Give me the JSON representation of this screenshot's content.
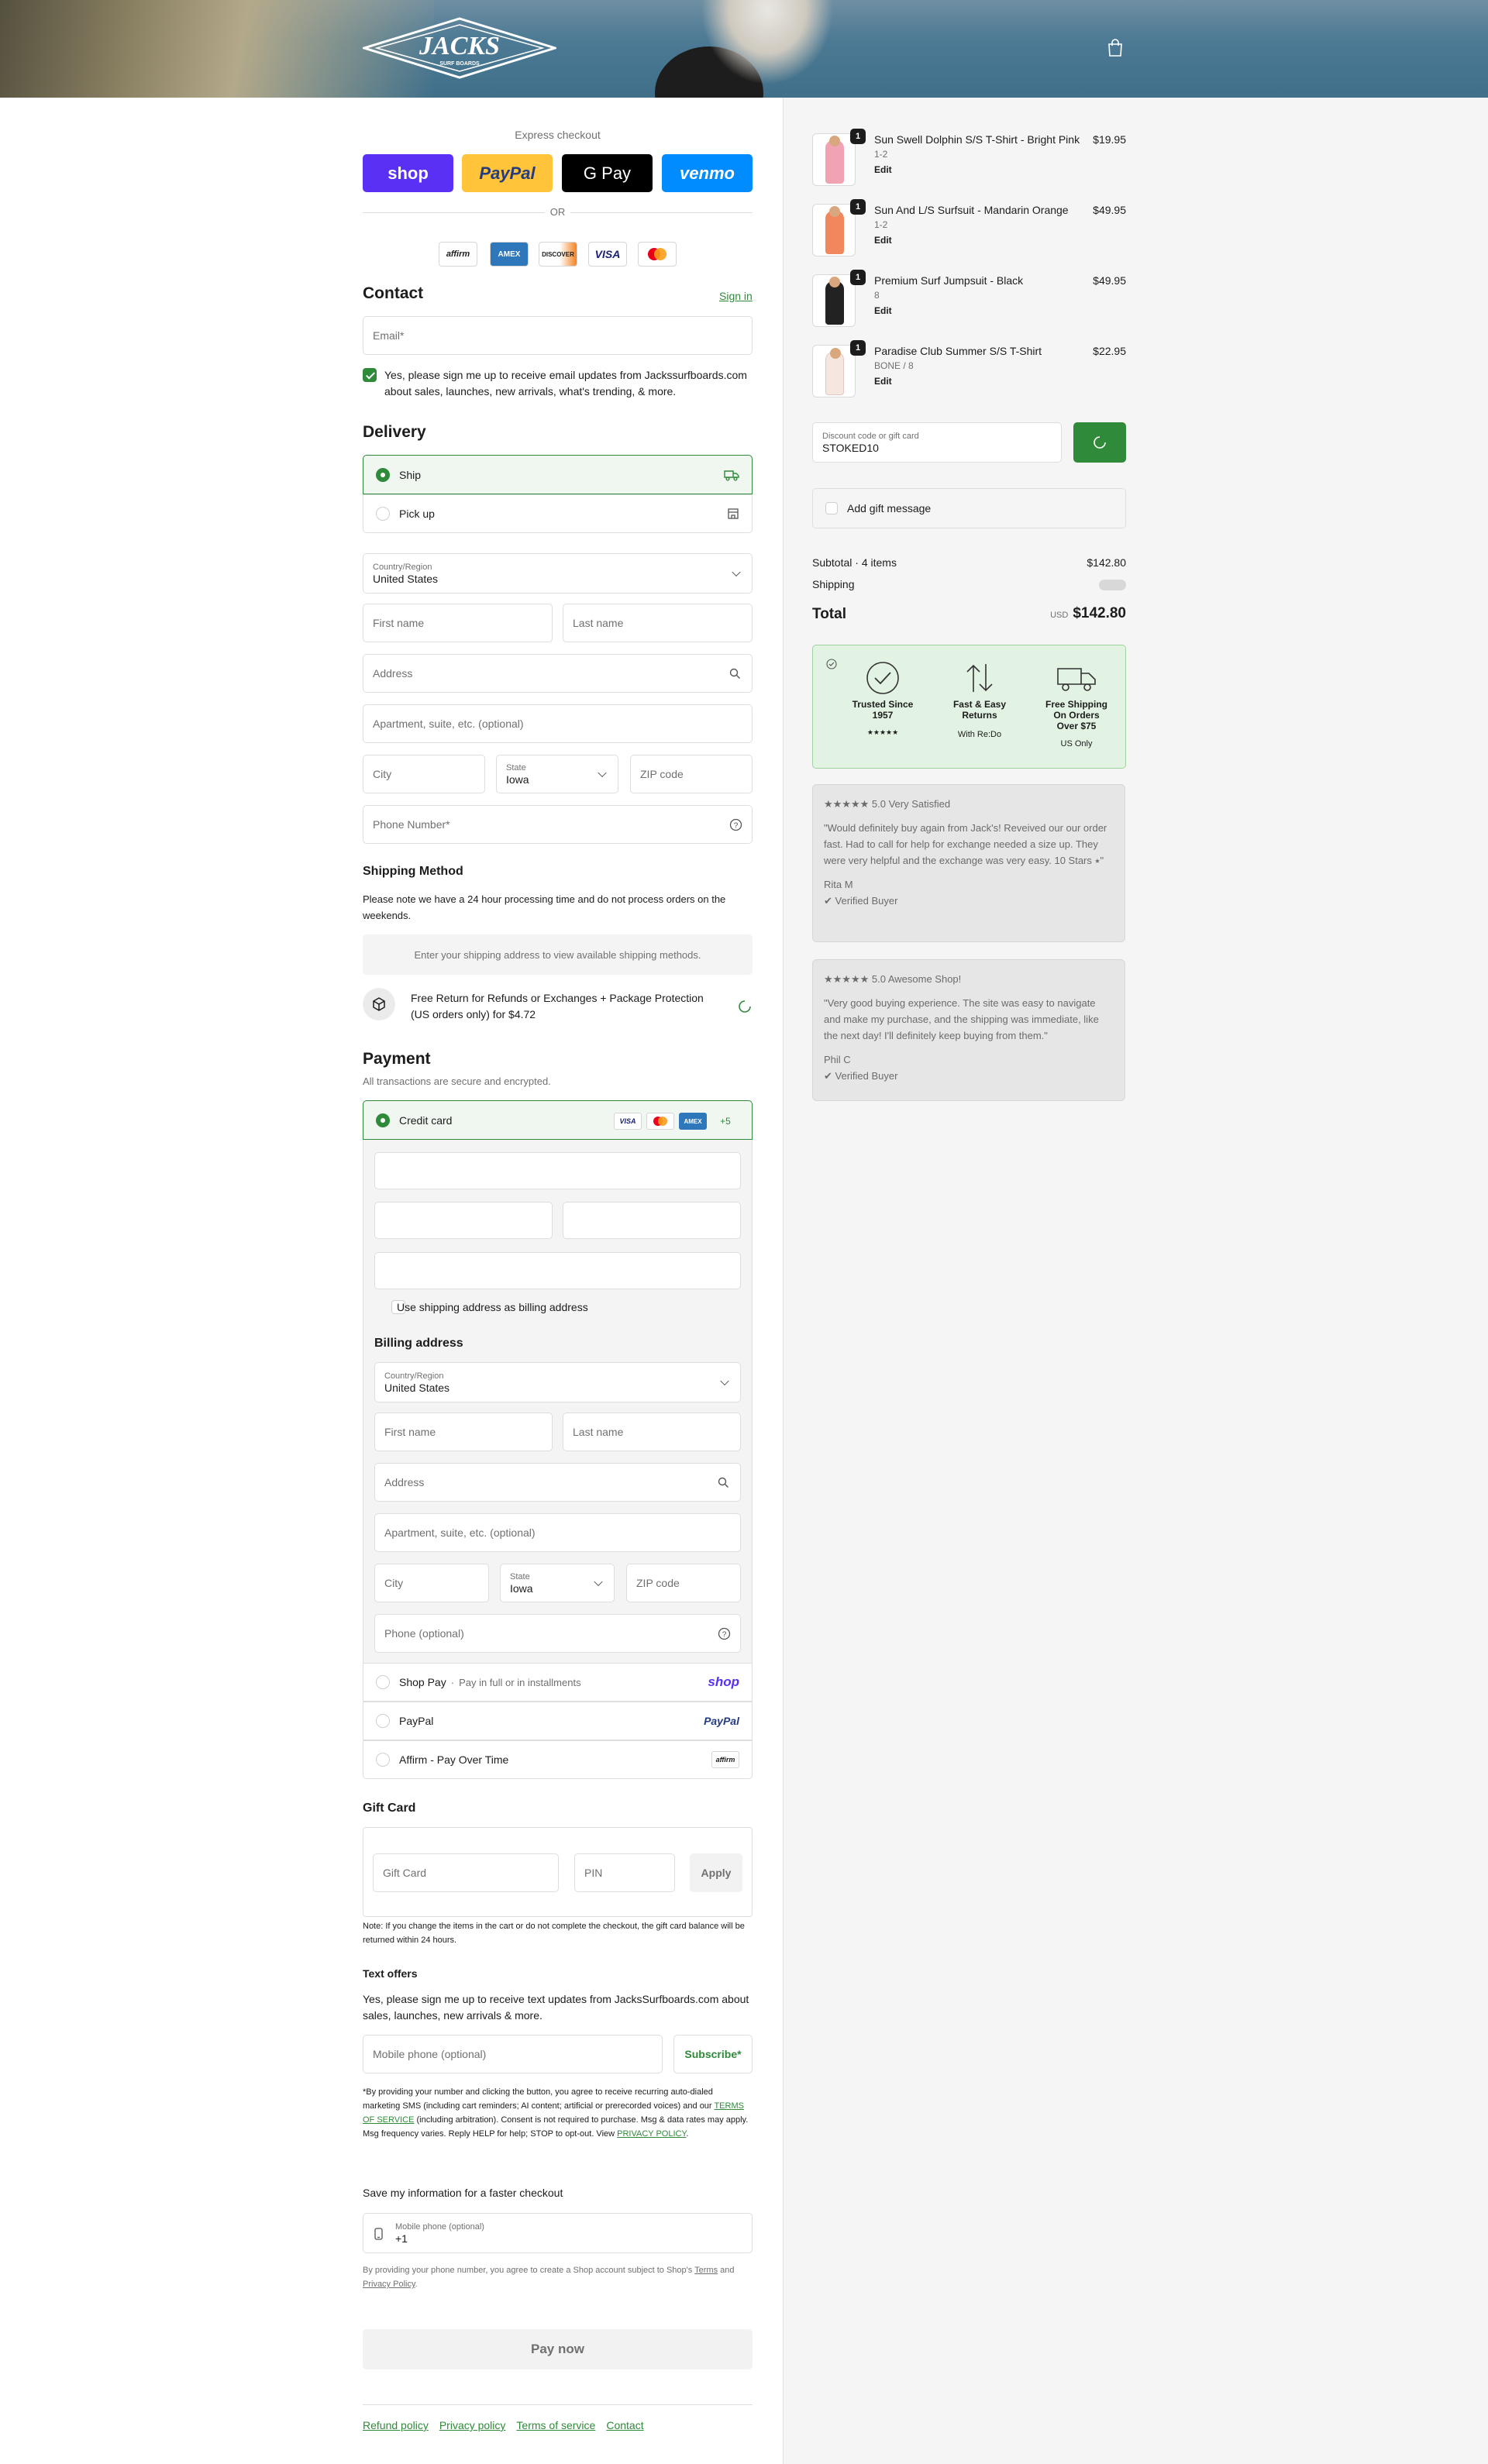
{
  "header": {
    "logo_text": "JACKS",
    "logo_subtext": "SURF BOARDS"
  },
  "express": {
    "title": "Express checkout",
    "buttons": {
      "shop": "shop",
      "paypal": "PayPal",
      "gpay": "G Pay",
      "venmo": "venmo"
    },
    "or": "OR",
    "cards": [
      "affirm",
      "AMEX",
      "DISCOVER",
      "VISA",
      "mastercard"
    ]
  },
  "contact": {
    "title": "Contact",
    "sign_in": "Sign in",
    "email_placeholder": "Email*",
    "newsletter": "Yes, please sign me up to receive email updates from Jackssurfboards.com about sales, launches, new arrivals, what's trending, & more."
  },
  "delivery": {
    "title": "Delivery",
    "ship": "Ship",
    "pickup": "Pick up",
    "country_label": "Country/Region",
    "country": "United States",
    "first_name": "First name",
    "last_name": "Last name",
    "address": "Address",
    "apartment": "Apartment, suite, etc. (optional)",
    "city": "City",
    "state_label": "State",
    "state": "Iowa",
    "zip": "ZIP code",
    "phone": "Phone Number*"
  },
  "shipping_method": {
    "title": "Shipping Method",
    "note": "Please note we have a 24 hour processing time and do not process orders on the weekends.",
    "empty": "Enter your shipping address to view available shipping methods.",
    "protection": "Free Return for Refunds or Exchanges + Package Protection (US orders only) for $4.72"
  },
  "payment": {
    "title": "Payment",
    "subtitle": "All transactions are secure and encrypted.",
    "credit_card": "Credit card",
    "more_cards": "+5",
    "card_brands": [
      "VISA",
      "mastercard",
      "AMEX"
    ],
    "use_shipping": "Use shipping address as billing address",
    "billing_title": "Billing address",
    "billing": {
      "country_label": "Country/Region",
      "country": "United States",
      "first_name": "First name",
      "last_name": "Last name",
      "address": "Address",
      "apartment": "Apartment, suite, etc. (optional)",
      "city": "City",
      "state_label": "State",
      "state": "Iowa",
      "zip": "ZIP code",
      "phone": "Phone (optional)"
    },
    "shop_pay": "Shop Pay",
    "shop_pay_sub": "Pay in full or in installments",
    "shop_pay_logo": "shop",
    "paypal": "PayPal",
    "paypal_logo": "PayPal",
    "affirm": "Affirm - Pay Over Time",
    "affirm_logo": "affirm"
  },
  "gift_card": {
    "title": "Gift Card",
    "placeholder": "Gift Card",
    "pin": "PIN",
    "apply": "Apply",
    "note": "Note: If you change the items in the cart or do not complete the checkout, the gift card balance will be returned within 24 hours."
  },
  "text_offers": {
    "title": "Text offers",
    "body": "Yes, please sign me up to receive text updates from JacksSurfboards.com about sales, launches, new arrivals & more.",
    "mobile_placeholder": "Mobile phone (optional)",
    "subscribe": "Subscribe*",
    "legal_1": "*By providing your number and clicking the button, you agree to receive recurring auto-dialed marketing SMS (including cart reminders; AI content; artificial or prerecorded voices) and our",
    "terms": "TERMS OF SERVICE",
    "legal_2": "(including arbitration). Consent is not required to purchase. Msg & data rates may apply. Msg frequency varies. Reply HELP for help; STOP to opt-out. View",
    "privacy": "PRIVACY POLICY",
    "legal_3": "."
  },
  "save_info": {
    "title": "Save my information for a faster checkout",
    "mobile_label": "Mobile phone (optional)",
    "mobile_value": "+1",
    "legal_1": "By providing your phone number, you agree to create a Shop account subject to Shop's",
    "terms": "Terms",
    "and": "and",
    "privacy": "Privacy Policy",
    "dot": "."
  },
  "pay_now": "Pay now",
  "footer": {
    "links": [
      "Refund policy",
      "Privacy policy",
      "Terms of service",
      "Contact"
    ]
  },
  "order": {
    "items": [
      {
        "qty": "1",
        "name": "Sun Swell Dolphin S/S T-Shirt - Bright Pink",
        "variant": "1-2",
        "edit": "Edit",
        "price": "$19.95",
        "color": "#f2a3b3"
      },
      {
        "qty": "1",
        "name": "Sun And L/S Surfsuit - Mandarin Orange",
        "variant": "1-2",
        "edit": "Edit",
        "price": "$49.95",
        "color": "#f2875e"
      },
      {
        "qty": "1",
        "name": "Premium Surf Jumpsuit - Black",
        "variant": "8",
        "edit": "Edit",
        "price": "$49.95",
        "color": "#222222"
      },
      {
        "qty": "1",
        "name": "Paradise Club Summer S/S T-Shirt",
        "variant": "BONE / 8",
        "edit": "Edit",
        "price": "$22.95",
        "color": "#f5e6e0"
      }
    ],
    "discount_label": "Discount code or gift card",
    "discount_value": "STOKED10",
    "gift_message": "Add gift message",
    "subtotal_label": "Subtotal · 4 items",
    "subtotal": "$142.80",
    "shipping_label": "Shipping",
    "total_label": "Total",
    "currency": "USD",
    "total": "$142.80"
  },
  "trust": {
    "items": [
      {
        "title": "Trusted Since 1957",
        "sub": "★★★★★"
      },
      {
        "title": "Fast & Easy Returns",
        "sub": "With Re:Do"
      },
      {
        "title": "Free Shipping On Orders Over $75",
        "sub": "US Only"
      }
    ]
  },
  "reviews": [
    {
      "head": "★★★★★ 5.0 Very Satisfied",
      "body": "\"Would definitely buy again from Jack's! Reveived our our order fast. Had to call for help for exchange needed a size up. They were very helpful and the exchange was very easy. 10 Stars ⭑\"",
      "author": "Rita M",
      "verified": "✔ Verified Buyer"
    },
    {
      "head": "★★★★★ 5.0 Awesome Shop!",
      "body": "\"Very good buying experience. The site was easy to navigate and make my purchase, and the shipping was immediate, like the next day! I'll definitely keep buying from them.\"",
      "author": "Phil C",
      "verified": "✔ Verified Buyer"
    }
  ],
  "colors": {
    "accent": "#2f8a3a",
    "shop": "#5a31f4",
    "paypal": "#ffc439",
    "venmo": "#008cff"
  }
}
